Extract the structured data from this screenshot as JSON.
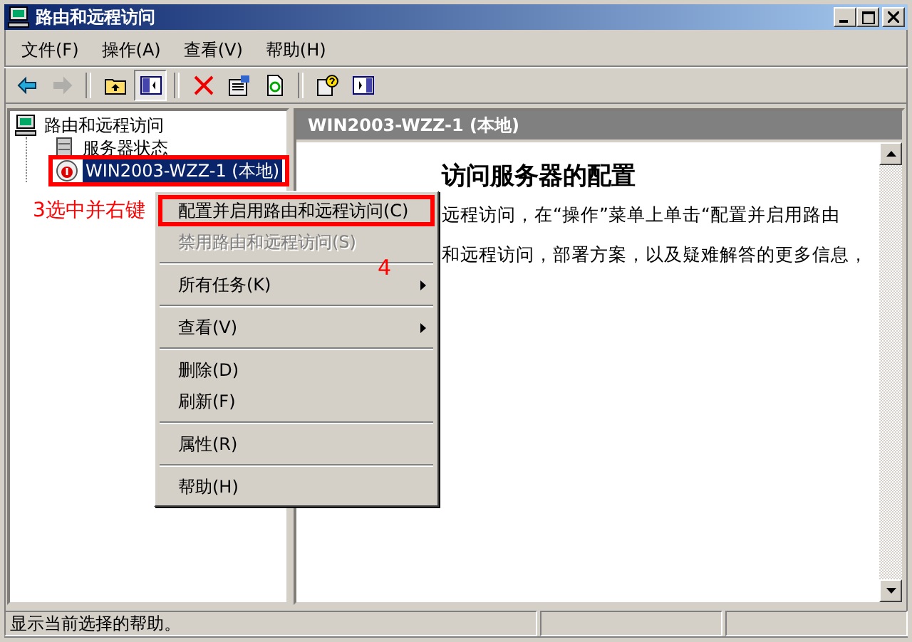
{
  "window": {
    "title": "路由和远程访问"
  },
  "menu_bar": [
    "文件(F)",
    "操作(A)",
    "查看(V)",
    "帮助(H)"
  ],
  "toolbar": [
    {
      "kind": "back",
      "disabled": false,
      "pressed": false
    },
    {
      "kind": "forward",
      "disabled": true,
      "pressed": false
    },
    {
      "kind": "sep"
    },
    {
      "kind": "up",
      "disabled": false,
      "pressed": false
    },
    {
      "kind": "tree",
      "disabled": false,
      "pressed": true
    },
    {
      "kind": "sep"
    },
    {
      "kind": "delete",
      "disabled": false,
      "pressed": false
    },
    {
      "kind": "properties",
      "disabled": false,
      "pressed": false
    },
    {
      "kind": "refresh",
      "disabled": false,
      "pressed": false
    },
    {
      "kind": "sep"
    },
    {
      "kind": "help",
      "disabled": false,
      "pressed": false
    },
    {
      "kind": "pane",
      "disabled": false,
      "pressed": false
    }
  ],
  "tree": [
    {
      "label": "路由和远程访问",
      "kind": "root",
      "selected": false,
      "children": [
        {
          "label": "服务器状态",
          "kind": "servers",
          "selected": false,
          "marked": false
        },
        {
          "label": "WIN2003-WZZ-1 (本地)",
          "kind": "server",
          "selected": true,
          "marked": true
        }
      ]
    }
  ],
  "details": {
    "header": "WIN2003-WZZ-1 (本地)",
    "heading": "访问服务器的配置",
    "lines": [
      "远程访问，在“操作”菜单上单击“配置并启用路由",
      "和远程访问，部署方案，以及疑难解答的更多信息，"
    ]
  },
  "context_menu": [
    {
      "kind": "item",
      "label": "配置并启用路由和远程访问(C)",
      "disabled": false,
      "submenu": false,
      "marked": true
    },
    {
      "kind": "item",
      "label": "禁用路由和远程访问(S)",
      "disabled": true,
      "submenu": false,
      "marked": false
    },
    {
      "kind": "sep"
    },
    {
      "kind": "item",
      "label": "所有任务(K)",
      "disabled": false,
      "submenu": true,
      "marked": false
    },
    {
      "kind": "sep"
    },
    {
      "kind": "item",
      "label": "查看(V)",
      "disabled": false,
      "submenu": true,
      "marked": false
    },
    {
      "kind": "sep"
    },
    {
      "kind": "item",
      "label": "删除(D)",
      "disabled": false,
      "submenu": false,
      "marked": false
    },
    {
      "kind": "item",
      "label": "刷新(F)",
      "disabled": false,
      "submenu": false,
      "marked": false
    },
    {
      "kind": "sep"
    },
    {
      "kind": "item",
      "label": "属性(R)",
      "disabled": false,
      "submenu": false,
      "marked": false
    },
    {
      "kind": "sep"
    },
    {
      "kind": "item",
      "label": "帮助(H)",
      "disabled": false,
      "submenu": false,
      "marked": false
    }
  ],
  "annotations": [
    "3选中并右键",
    "4"
  ],
  "status_bar": [
    "显示当前选择的帮助。"
  ]
}
